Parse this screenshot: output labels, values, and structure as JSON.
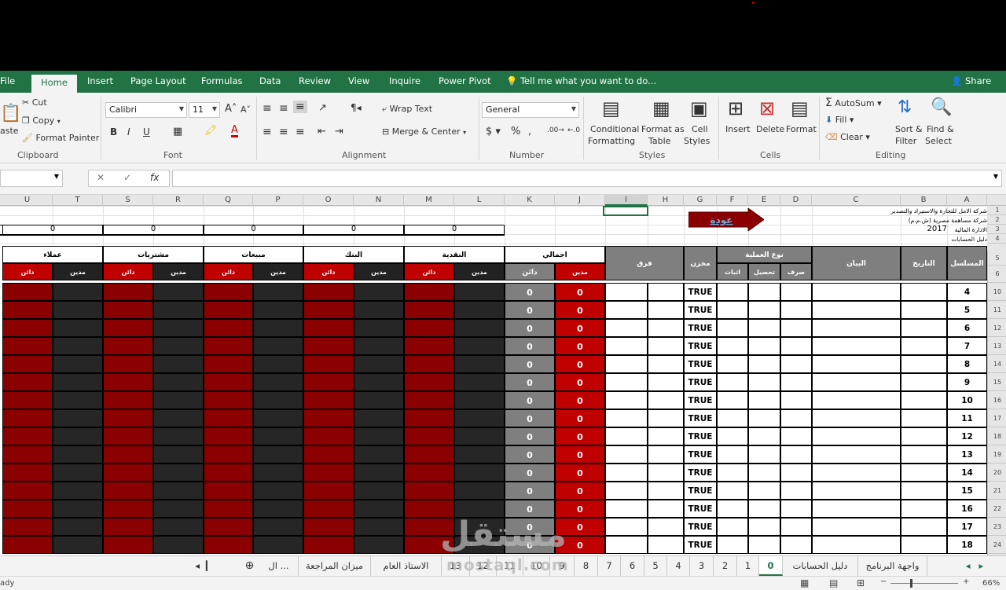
{
  "tabs": [
    "File",
    "Home",
    "Insert",
    "Page Layout",
    "Formulas",
    "Data",
    "Review",
    "View",
    "Inquire",
    "Power Pivot"
  ],
  "tell_me": "Tell me what you want to do...",
  "share": "Share",
  "clipboard": {
    "paste": "aste",
    "cut": "Cut",
    "copy": "Copy",
    "format_painter": "Format Painter",
    "label": "Clipboard"
  },
  "font": {
    "name": "Calibri",
    "size": "11",
    "label": "Font"
  },
  "alignment": {
    "wrap": "Wrap Text",
    "merge": "Merge & Center",
    "label": "Alignment"
  },
  "number": {
    "format": "General",
    "label": "Number"
  },
  "styles": {
    "conditional": "Conditional",
    "conditional2": "Formatting",
    "format_as": "Format as",
    "table": "Table",
    "cell": "Cell",
    "cell_styles": "Styles",
    "label": "Styles"
  },
  "cells": {
    "insert": "Insert",
    "delete": "Delete",
    "format": "Format",
    "label": "Cells"
  },
  "editing": {
    "autosum": "AutoSum",
    "fill": "Fill",
    "clear": "Clear",
    "sort": "Sort &",
    "filter": "Filter",
    "find": "Find &",
    "select": "Select",
    "label": "Editing"
  },
  "fx": "fx",
  "columns": [
    "U",
    "T",
    "S",
    "R",
    "Q",
    "P",
    "O",
    "N",
    "M",
    "L",
    "K",
    "J",
    "I",
    "H",
    "G",
    "F",
    "E",
    "D",
    "C",
    "B",
    "A"
  ],
  "rows": [
    "1",
    "2",
    "3",
    "4",
    "5",
    "6",
    "10",
    "11",
    "12",
    "13",
    "14",
    "15",
    "16",
    "17",
    "18",
    "19",
    "20",
    "21",
    "22",
    "23",
    "24"
  ],
  "company": {
    "line1": "شركة الامل للتجارة والاستيراد والتصدير",
    "line2": "شركة مساهمة  مصرية (ش.م.م)",
    "line3": "الادارة المالية",
    "year": "2017",
    "line4": "دليل الحسابات"
  },
  "return_button": "عودة",
  "zero": "0",
  "headers": {
    "serial": "المسلسل",
    "date": "التاريخ",
    "statement": "البيان",
    "op_type": "نوع العملية",
    "spend": "صرف",
    "collect": "تحصيل",
    "proof": "اثبات",
    "store": "مخزن",
    "diff": "فرق",
    "total": "اجمالي",
    "cash": "النقدية",
    "bank": "البنك",
    "sales": "مبيعات",
    "purchases": "مشتريات",
    "clients": "عملاء",
    "debit": "مدين",
    "credit": "دائن"
  },
  "serials": [
    "4",
    "5",
    "6",
    "7",
    "8",
    "9",
    "10",
    "11",
    "12",
    "13",
    "14",
    "15",
    "16",
    "17",
    "18"
  ],
  "true_val": "TRUE",
  "sheet_tabs": [
    "واجهة البرنامج",
    "دليل الحسابات",
    "0",
    "1",
    "2",
    "3",
    "4",
    "5",
    "6",
    "7",
    "8",
    "9",
    "10",
    "11",
    "12",
    "13",
    "الاستاذ العام",
    "ميزان المراجعة",
    "ال ..."
  ],
  "status": {
    "ready": "ady",
    "zoom": "66%"
  },
  "watermark": {
    "ar": "مستقل",
    "en": "mostaql.com"
  }
}
